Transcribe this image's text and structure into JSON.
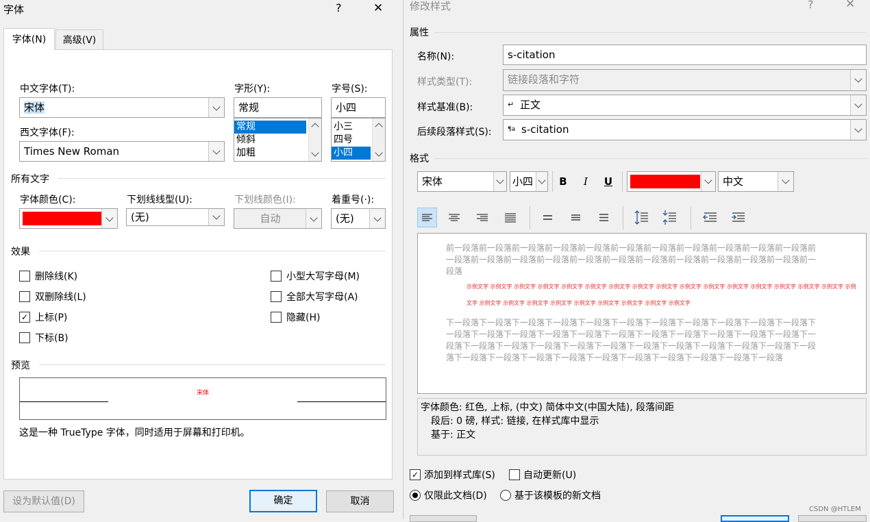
{
  "font_dialog": {
    "title": "字体",
    "help": "?",
    "close": "✕",
    "tabs": [
      {
        "label": "字体(N)"
      },
      {
        "label": "高级(V)"
      }
    ],
    "chinese_font": {
      "label": "中文字体(T):",
      "value": "宋体"
    },
    "style": {
      "label": "字形(Y):",
      "value": "常规",
      "options": [
        "常规",
        "倾斜",
        "加粗"
      ]
    },
    "size": {
      "label": "字号(S):",
      "value": "小四",
      "options": [
        "小三",
        "四号",
        "小四"
      ]
    },
    "western_font": {
      "label": "西文字体(F):",
      "value": "Times New Roman"
    },
    "all_text_header": "所有文字",
    "font_color": {
      "label": "字体颜色(C):",
      "value": "#ff0000"
    },
    "underline_style": {
      "label": "下划线线型(U):",
      "value": "(无)"
    },
    "underline_color": {
      "label": "下划线颜色(I):",
      "value": "自动"
    },
    "emphasis": {
      "label": "着重号(·):",
      "value": "(无)"
    },
    "effects_header": "效果",
    "effects_left": [
      {
        "label": "删除线(K)",
        "checked": false
      },
      {
        "label": "双删除线(L)",
        "checked": false
      },
      {
        "label": "上标(P)",
        "checked": true
      },
      {
        "label": "下标(B)",
        "checked": false
      }
    ],
    "effects_right": [
      {
        "label": "小型大写字母(M)",
        "checked": false
      },
      {
        "label": "全部大写字母(A)",
        "checked": false
      },
      {
        "label": "隐藏(H)",
        "checked": false
      }
    ],
    "preview_header": "预览",
    "preview_text": "宋体",
    "description": "这是一种 TrueType 字体，同时适用于屏幕和打印机。",
    "buttons": {
      "default": "设为默认值(D)",
      "ok": "确定",
      "cancel": "取消"
    }
  },
  "modify_style": {
    "title": "修改样式",
    "help": "?",
    "close": "✕",
    "properties_header": "属性",
    "name": {
      "label": "名称(N):",
      "value": "s-citation"
    },
    "style_type": {
      "label": "样式类型(T):",
      "value": "链接段落和字符"
    },
    "style_based_on": {
      "label": "样式基准(B):",
      "value": "正文",
      "icon_glyph": "↵"
    },
    "next_style": {
      "label": "后续段落样式(S):",
      "value": "s-citation",
      "icon_glyph": "¶a"
    },
    "format_header": "格式",
    "font_name": "宋体",
    "font_size": "小四",
    "bold": "B",
    "italic": "I",
    "underline": "U",
    "color": "#ff0000",
    "script": "中文",
    "preview": {
      "before": "前一段落前一段落前一段落前一段落前一段落前一段落前一段落前一段落前一段落前一段落前一段落前一段落前一段落前一段落前一段落前一段落前一段落前一段落前一段落前一段落前一段落前一段落前一段落",
      "sample": "示例文字 示例文字 示例文字 示例文字 示例文字 示例文字 示例文字 示例文字 示例文字 示例文字 示例文字 示例文字 示例文字 示例文字 示例文字 示例文字 示例文字 示例文字 示例文字 示例文字 示例文字 示例文字 示例文字 示例文字 示例文字 示例文字",
      "after": "下一段落下一段落下一段落下一段落下一段落下一段落下一段落下一段落下一段落下一段落下一段落下一段落下一段落下一段落下一段落下一段落下一段落下一段落下一段落下一段落下一段落下一段落下一段落下一段落下一段落下一段落下一段落下一段落下一段落下一段落下一段落下一段落下一段落下一段落下一段落下一段落下一段落下一段落下一段落下一段落下一段落下一段落下一段落下一段落"
    },
    "description_lines": [
      "字体颜色: 红色, 上标, (中文) 简体中文(中国大陆), 段落间距",
      "段后: 0 磅, 样式: 链接, 在样式库中显示",
      "基于: 正文"
    ],
    "add_to_gallery": {
      "label": "添加到样式库(S)",
      "checked": true
    },
    "auto_update": {
      "label": "自动更新(U)",
      "checked": false
    },
    "only_this_doc": {
      "label": "仅限此文档(D)",
      "selected": true
    },
    "new_docs": {
      "label": "基于该模板的新文档",
      "selected": false
    }
  },
  "watermark": "CSDN @HTLEM"
}
